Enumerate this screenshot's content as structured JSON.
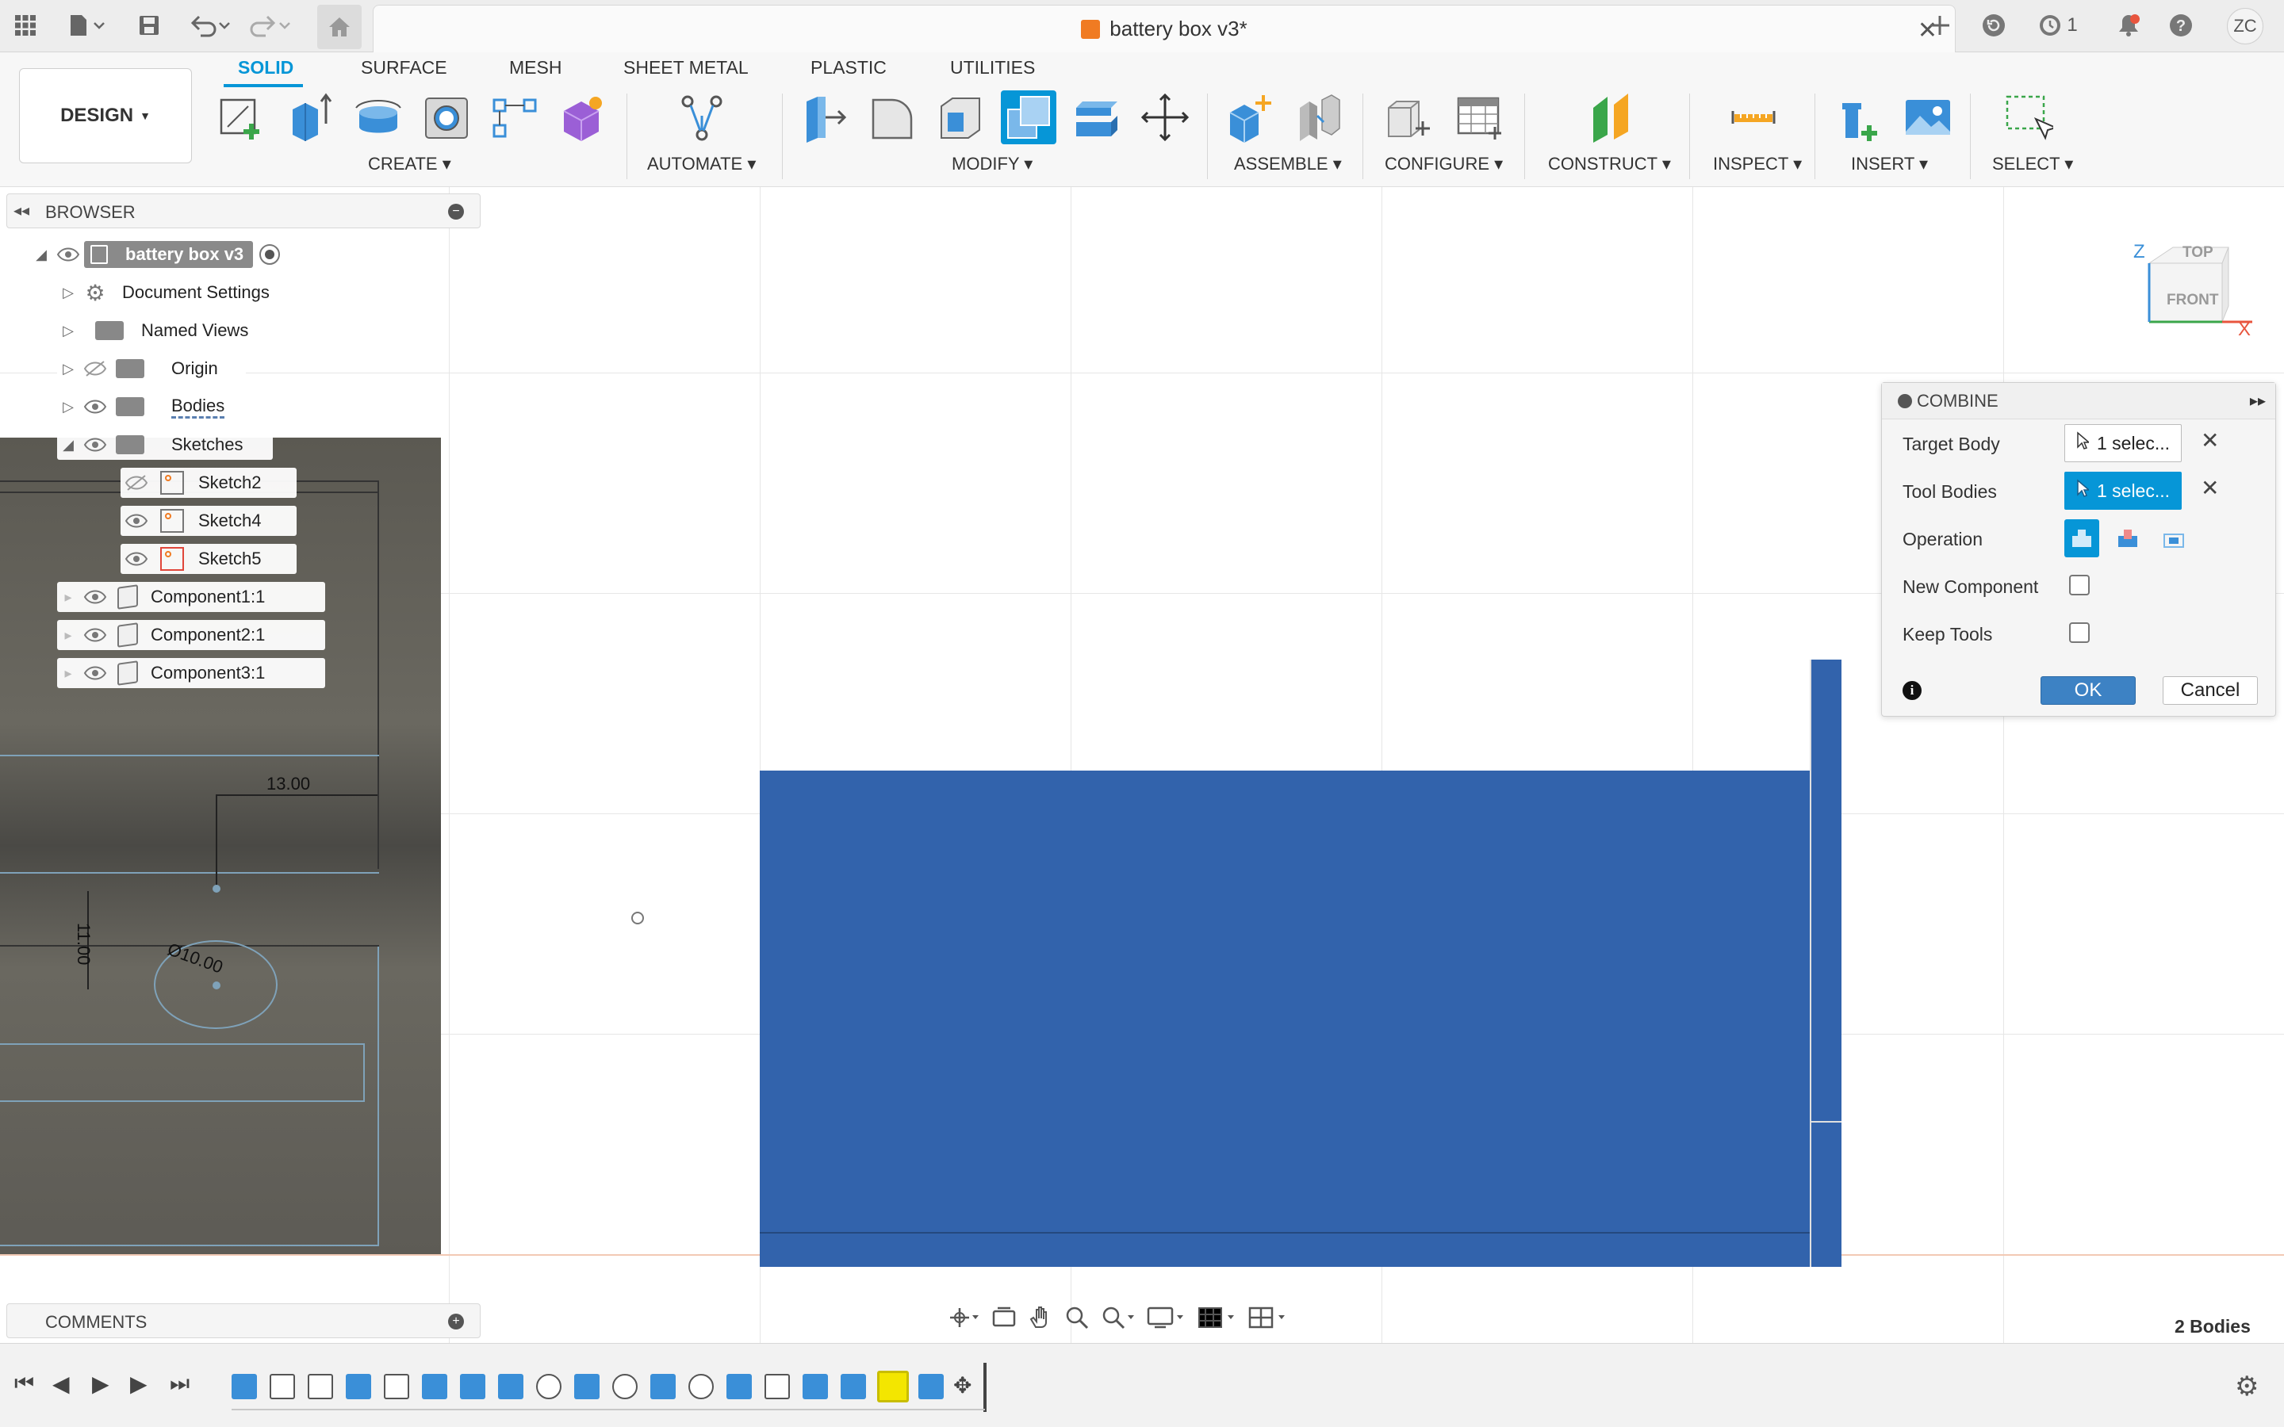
{
  "window": {
    "document_title": "battery box v3*",
    "job_count": "1",
    "user_initials": "ZC"
  },
  "toolbar": {
    "workspace": "DESIGN",
    "tabs": [
      "SOLID",
      "SURFACE",
      "MESH",
      "SHEET METAL",
      "PLASTIC",
      "UTILITIES"
    ],
    "groups": [
      "CREATE",
      "AUTOMATE",
      "MODIFY",
      "ASSEMBLE",
      "CONFIGURE",
      "CONSTRUCT",
      "INSPECT",
      "INSERT",
      "SELECT"
    ]
  },
  "browser": {
    "title": "BROWSER",
    "root": "battery box v3",
    "items": [
      "Document Settings",
      "Named Views",
      "Origin",
      "Bodies",
      "Sketches"
    ],
    "sketches": [
      "Sketch2",
      "Sketch4",
      "Sketch5"
    ],
    "components": [
      "Component1:1",
      "Component2:1",
      "Component3:1"
    ]
  },
  "sketch": {
    "dim_width": "13.00",
    "dim_height": "11.00",
    "dim_diameter": "Ø10.00"
  },
  "viewcube": {
    "top": "TOP",
    "front": "FRONT",
    "axis_z": "Z",
    "axis_x": "X"
  },
  "combine": {
    "title": "COMBINE",
    "target_body_label": "Target Body",
    "target_body_value": "1 selec...",
    "tool_bodies_label": "Tool Bodies",
    "tool_bodies_value": "1 selec...",
    "operation_label": "Operation",
    "new_component_label": "New Component",
    "keep_tools_label": "Keep Tools",
    "ok": "OK",
    "cancel": "Cancel"
  },
  "comments": {
    "title": "COMMENTS"
  },
  "status": {
    "bodies_count": "2 Bodies"
  },
  "colors": {
    "accent": "#0696d7",
    "body": "#3263ac",
    "sketch_bg": "#5e5c56"
  }
}
